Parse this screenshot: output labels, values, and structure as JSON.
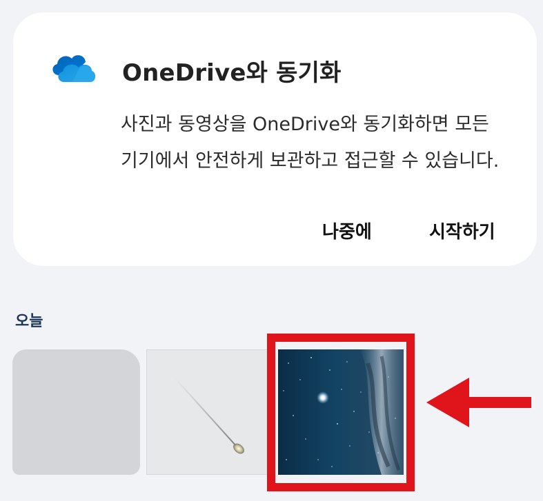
{
  "sync_card": {
    "title": "OneDrive와 동기화",
    "description": "사진과 동영상을 OneDrive와 동기화하면 모든 기기에서 안전하게 보관하고 접근할 수 있습니다.",
    "later_button": "나중에",
    "start_button": "시작하기",
    "icon": "onedrive-cloud-icon"
  },
  "gallery": {
    "section_label": "오늘",
    "thumbnails": [
      {
        "name": "blurred-photo"
      },
      {
        "name": "meteor-photo"
      },
      {
        "name": "starry-sky-photo",
        "highlighted": true
      }
    ]
  },
  "annotation": {
    "color": "#e0141b"
  }
}
